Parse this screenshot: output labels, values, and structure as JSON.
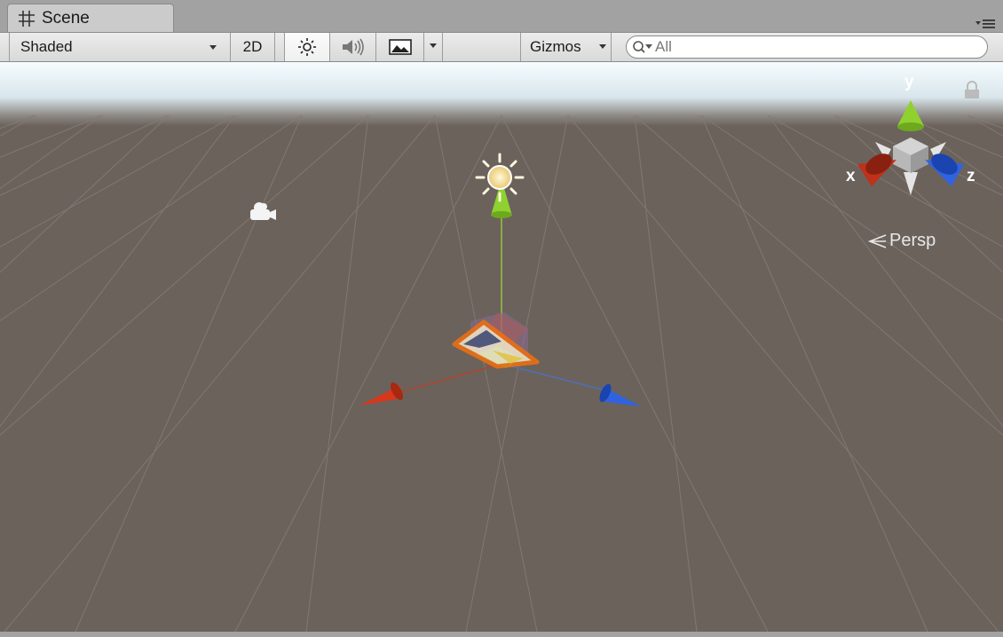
{
  "tab": {
    "title": "Scene",
    "icon": "grid-icon"
  },
  "toolbar": {
    "draw_mode": "Shaded",
    "mode_2d": "2D",
    "lighting_icon": "sun-icon",
    "audio_icon": "speaker-icon",
    "effects_icon": "image-icon",
    "gizmos": "Gizmos",
    "search_value": "All"
  },
  "gizmo": {
    "y_label": "y",
    "x_label": "x",
    "z_label": "z",
    "projection": "Persp"
  },
  "colors": {
    "x_axis": "#d8371a",
    "y_axis": "#8fd12f",
    "z_axis": "#2f63e0",
    "selection": "#f07010",
    "ground": "#6b625c"
  }
}
